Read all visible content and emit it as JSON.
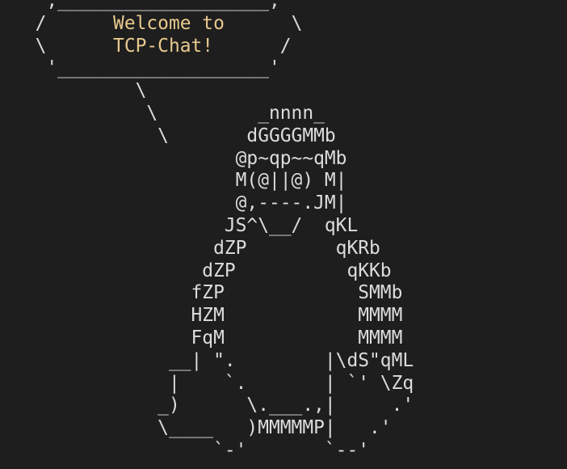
{
  "banner": {
    "top": "   ,___________________,",
    "line1_left": "  /     ",
    "line1_text": " Welcome to ",
    "line1_right": "     \\",
    "line2_left": "  \\      ",
    "line2_text": "TCP-Chat!",
    "line2_right": "      /",
    "bottom": "   '___________________'"
  },
  "art": [
    "           \\",
    "            \\         _nnnn_",
    "             \\       dGGGGMMb",
    "                    @p~qp~~qMb",
    "                    M(@||@) M|",
    "                    @,----.JM|",
    "                   JS^\\__/  qKL",
    "                  dZP        qKRb",
    "                 dZP          qKKb",
    "                fZP            SMMb",
    "                HZM            MMMM",
    "                FqM            MMMM",
    "              __| \".        |\\dS\"qML",
    "              |    `.       | `' \\Zq",
    "             _)      \\.___.,|     .'",
    "             \\____   )MMMMMP|   .'",
    "                  `-'       `--'"
  ]
}
